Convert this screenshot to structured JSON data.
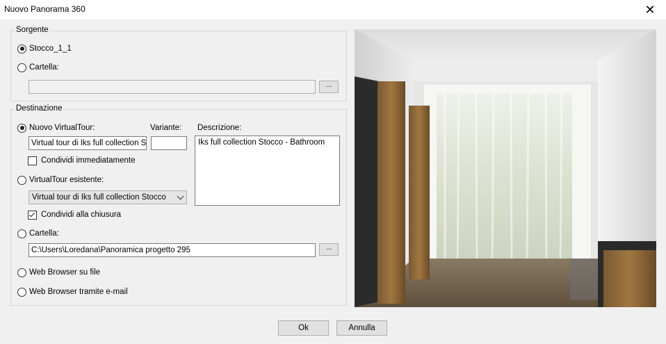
{
  "window": {
    "title": "Nuovo Panorama 360",
    "close_glyph": "✕"
  },
  "source_group": {
    "label": "Sorgente",
    "option_stock": "Stocco_1_1",
    "option_folder": "Cartella:",
    "folder_value": "",
    "browse_label": "..."
  },
  "destination_group": {
    "label": "Destinazione",
    "option_new_tour": "Nuovo VirtualTour:",
    "variant_label": "Variante:",
    "description_label": "Descrizione:",
    "new_tour_name": "Virtual tour di Iks full collection Sto",
    "variant_value": "",
    "description_value": "Iks full collection Stocco - Bathroom",
    "share_now": "Condividi immediatamente",
    "option_existing_tour": "VirtualTour esistente:",
    "existing_tour_selected": "Virtual tour di Iks full collection Stocco",
    "share_on_close": "Condividi alla chiusura",
    "option_folder": "Cartella:",
    "folder_path": "C:\\Users\\Loredana\\Panoramica progetto 295",
    "browse_label": "...",
    "option_web_file": "Web Browser su file",
    "option_web_email": "Web Browser tramite e-mail"
  },
  "buttons": {
    "ok": "Ok",
    "cancel": "Annulla"
  }
}
